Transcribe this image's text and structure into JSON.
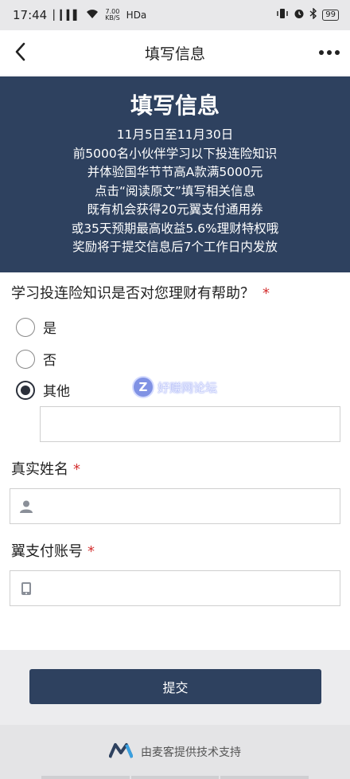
{
  "status_bar": {
    "time": "17:44",
    "signal": "▏▎▍▌",
    "speed_value": "7.00",
    "speed_unit": "KB/S",
    "network": "HDa",
    "battery": "99"
  },
  "nav": {
    "title": "填写信息"
  },
  "banner": {
    "title": "填写信息",
    "lines": [
      "11月5日至11月30日",
      "前5000名小伙伴学习以下投连险知识",
      "并体验国华节节高A款满5000元",
      "点击“阅读原文”填写相关信息",
      "既有机会获得20元翼支付通用券",
      "或35天预期最高收益5.6%理财特权哦",
      "奖励将于提交信息后7个工作日内发放"
    ]
  },
  "question": {
    "label": "学习投连险知识是否对您理财有帮助？",
    "required_mark": "*",
    "options": [
      "是",
      "否",
      "其他"
    ],
    "selected": "其他",
    "other_value": ""
  },
  "name_field": {
    "label": "真实姓名",
    "required_mark": "*",
    "value": ""
  },
  "account_field": {
    "label": "翼支付账号",
    "required_mark": "*",
    "value": ""
  },
  "submit": {
    "label": "提交"
  },
  "watermark": {
    "logo_letter": "Z",
    "text": "好赚网论坛"
  },
  "footer": {
    "text": "由麦客提供技术支持"
  },
  "colors": {
    "primary": "#2e415f",
    "required": "#d43030",
    "page_bg": "#f2f2f4"
  }
}
